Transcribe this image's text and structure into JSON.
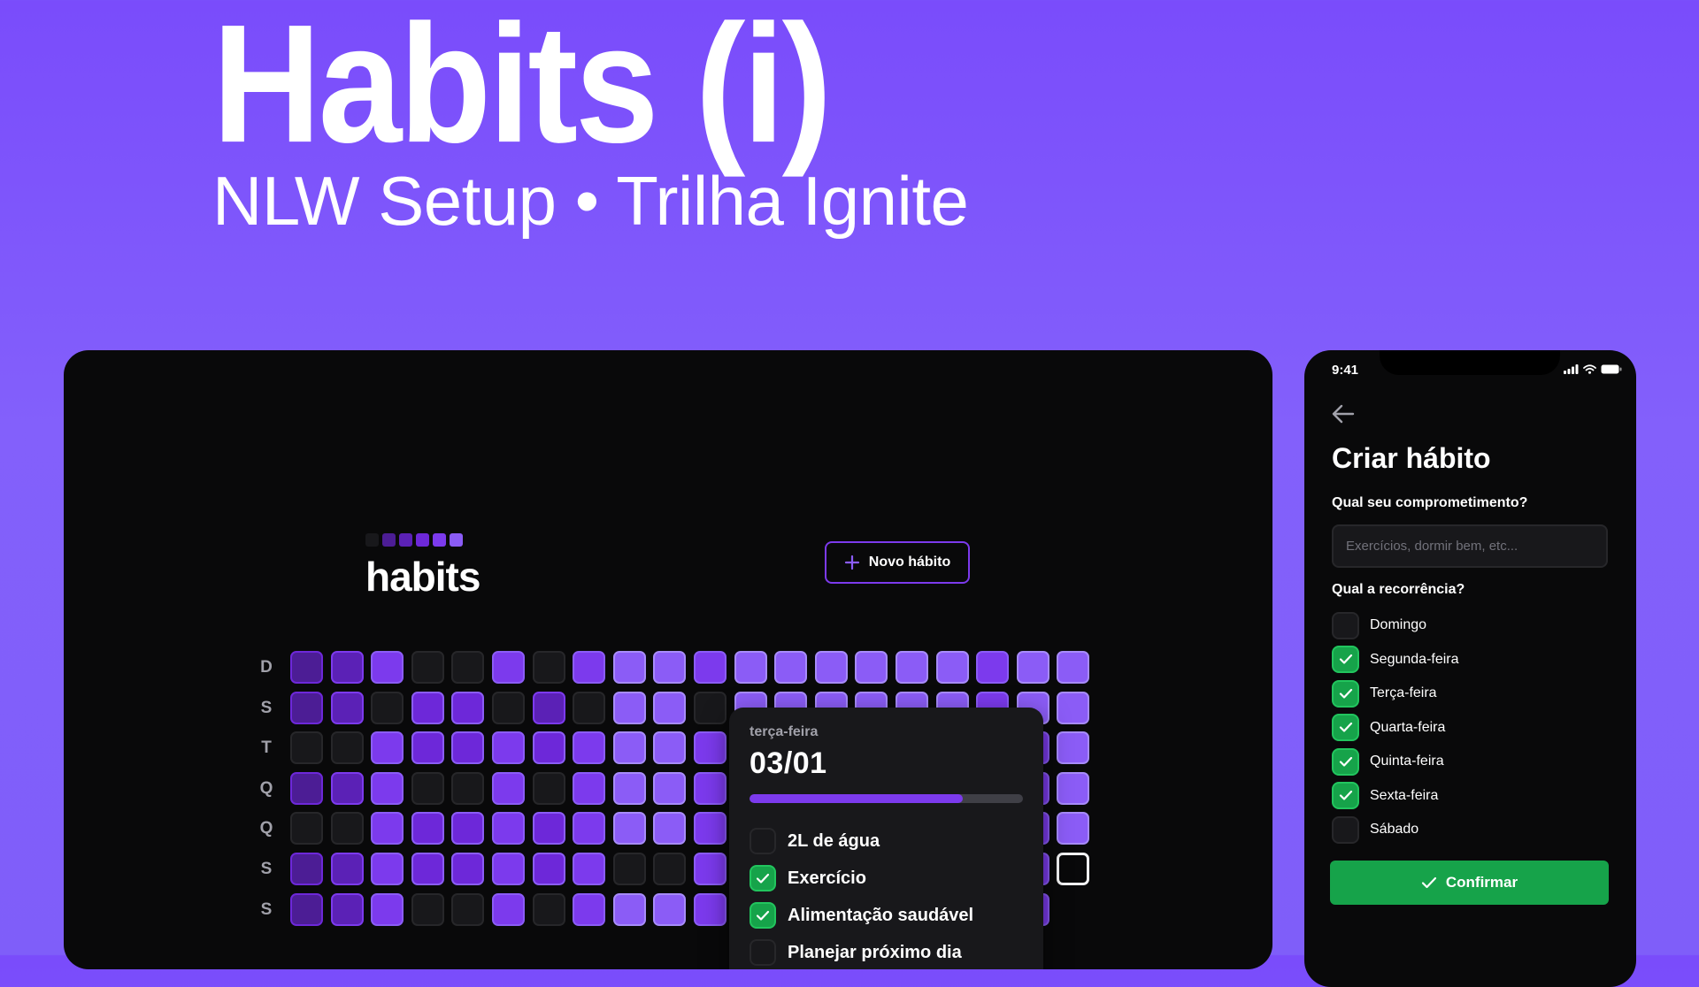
{
  "hero": {
    "title": "Habits (i)",
    "subtitle": "NLW Setup • Trilha Ignite"
  },
  "desktop": {
    "brand": "habits",
    "logo_colors": [
      "#18181b",
      "#4c1d95",
      "#5b21b6",
      "#6d28d9",
      "#7c3aed",
      "#8b5cf6"
    ],
    "new_habit_button": {
      "label": "Novo hábito",
      "icon": "plus-icon"
    },
    "weekdays": [
      "D",
      "S",
      "T",
      "Q",
      "Q",
      "S",
      "S"
    ],
    "summary_grid": [
      [
        1,
        2,
        4,
        0,
        0,
        4,
        0,
        4,
        5,
        5,
        4,
        5,
        5,
        5,
        5,
        5,
        5,
        4,
        5,
        5
      ],
      [
        1,
        2,
        0,
        3,
        3,
        0,
        2,
        0,
        5,
        5,
        0,
        5,
        5,
        5,
        5,
        5,
        5,
        4,
        5,
        5
      ],
      [
        0,
        0,
        4,
        3,
        3,
        4,
        3,
        4,
        5,
        5,
        4,
        4,
        4,
        4,
        4,
        4,
        4,
        4,
        4,
        5
      ],
      [
        1,
        2,
        4,
        0,
        0,
        4,
        0,
        4,
        5,
        5,
        4,
        4,
        4,
        4,
        4,
        4,
        4,
        4,
        4,
        5
      ],
      [
        0,
        0,
        4,
        3,
        3,
        4,
        3,
        4,
        5,
        5,
        4,
        4,
        4,
        4,
        4,
        4,
        4,
        4,
        4,
        5
      ],
      [
        1,
        2,
        4,
        3,
        3,
        4,
        3,
        4,
        0,
        0,
        4,
        4,
        4,
        4,
        4,
        4,
        4,
        4,
        4,
        "today"
      ],
      [
        1,
        2,
        4,
        0,
        0,
        4,
        0,
        4,
        5,
        5,
        4,
        4,
        4,
        4,
        4,
        4,
        4,
        4,
        4,
        null
      ]
    ],
    "popover": {
      "weekday": "terça-feira",
      "date": "03/01",
      "progress": 0.78,
      "habits": [
        {
          "label": "2L de água",
          "checked": false
        },
        {
          "label": "Exercício",
          "checked": true
        },
        {
          "label": "Alimentação saudável",
          "checked": true
        },
        {
          "label": "Planejar próximo dia",
          "checked": false
        }
      ]
    }
  },
  "phone": {
    "status_time": "9:41",
    "status_icons": [
      "signal-icon",
      "wifi-icon",
      "battery-icon"
    ],
    "back_icon": "arrow-left-icon",
    "title": "Criar hábito",
    "commitment_label": "Qual seu comprometimento?",
    "commitment_placeholder": "Exercícios, dormir bem, etc...",
    "recurrence_label": "Qual a recorrência?",
    "days": [
      {
        "label": "Domingo",
        "checked": false
      },
      {
        "label": "Segunda-feira",
        "checked": true
      },
      {
        "label": "Terça-feira",
        "checked": true
      },
      {
        "label": "Quarta-feira",
        "checked": true
      },
      {
        "label": "Quinta-feira",
        "checked": true
      },
      {
        "label": "Sexta-feira",
        "checked": true
      },
      {
        "label": "Sábado",
        "checked": false
      }
    ],
    "confirm_button": "Confirmar",
    "accent_green": "#16a34a",
    "accent_violet": "#7c3aed"
  }
}
